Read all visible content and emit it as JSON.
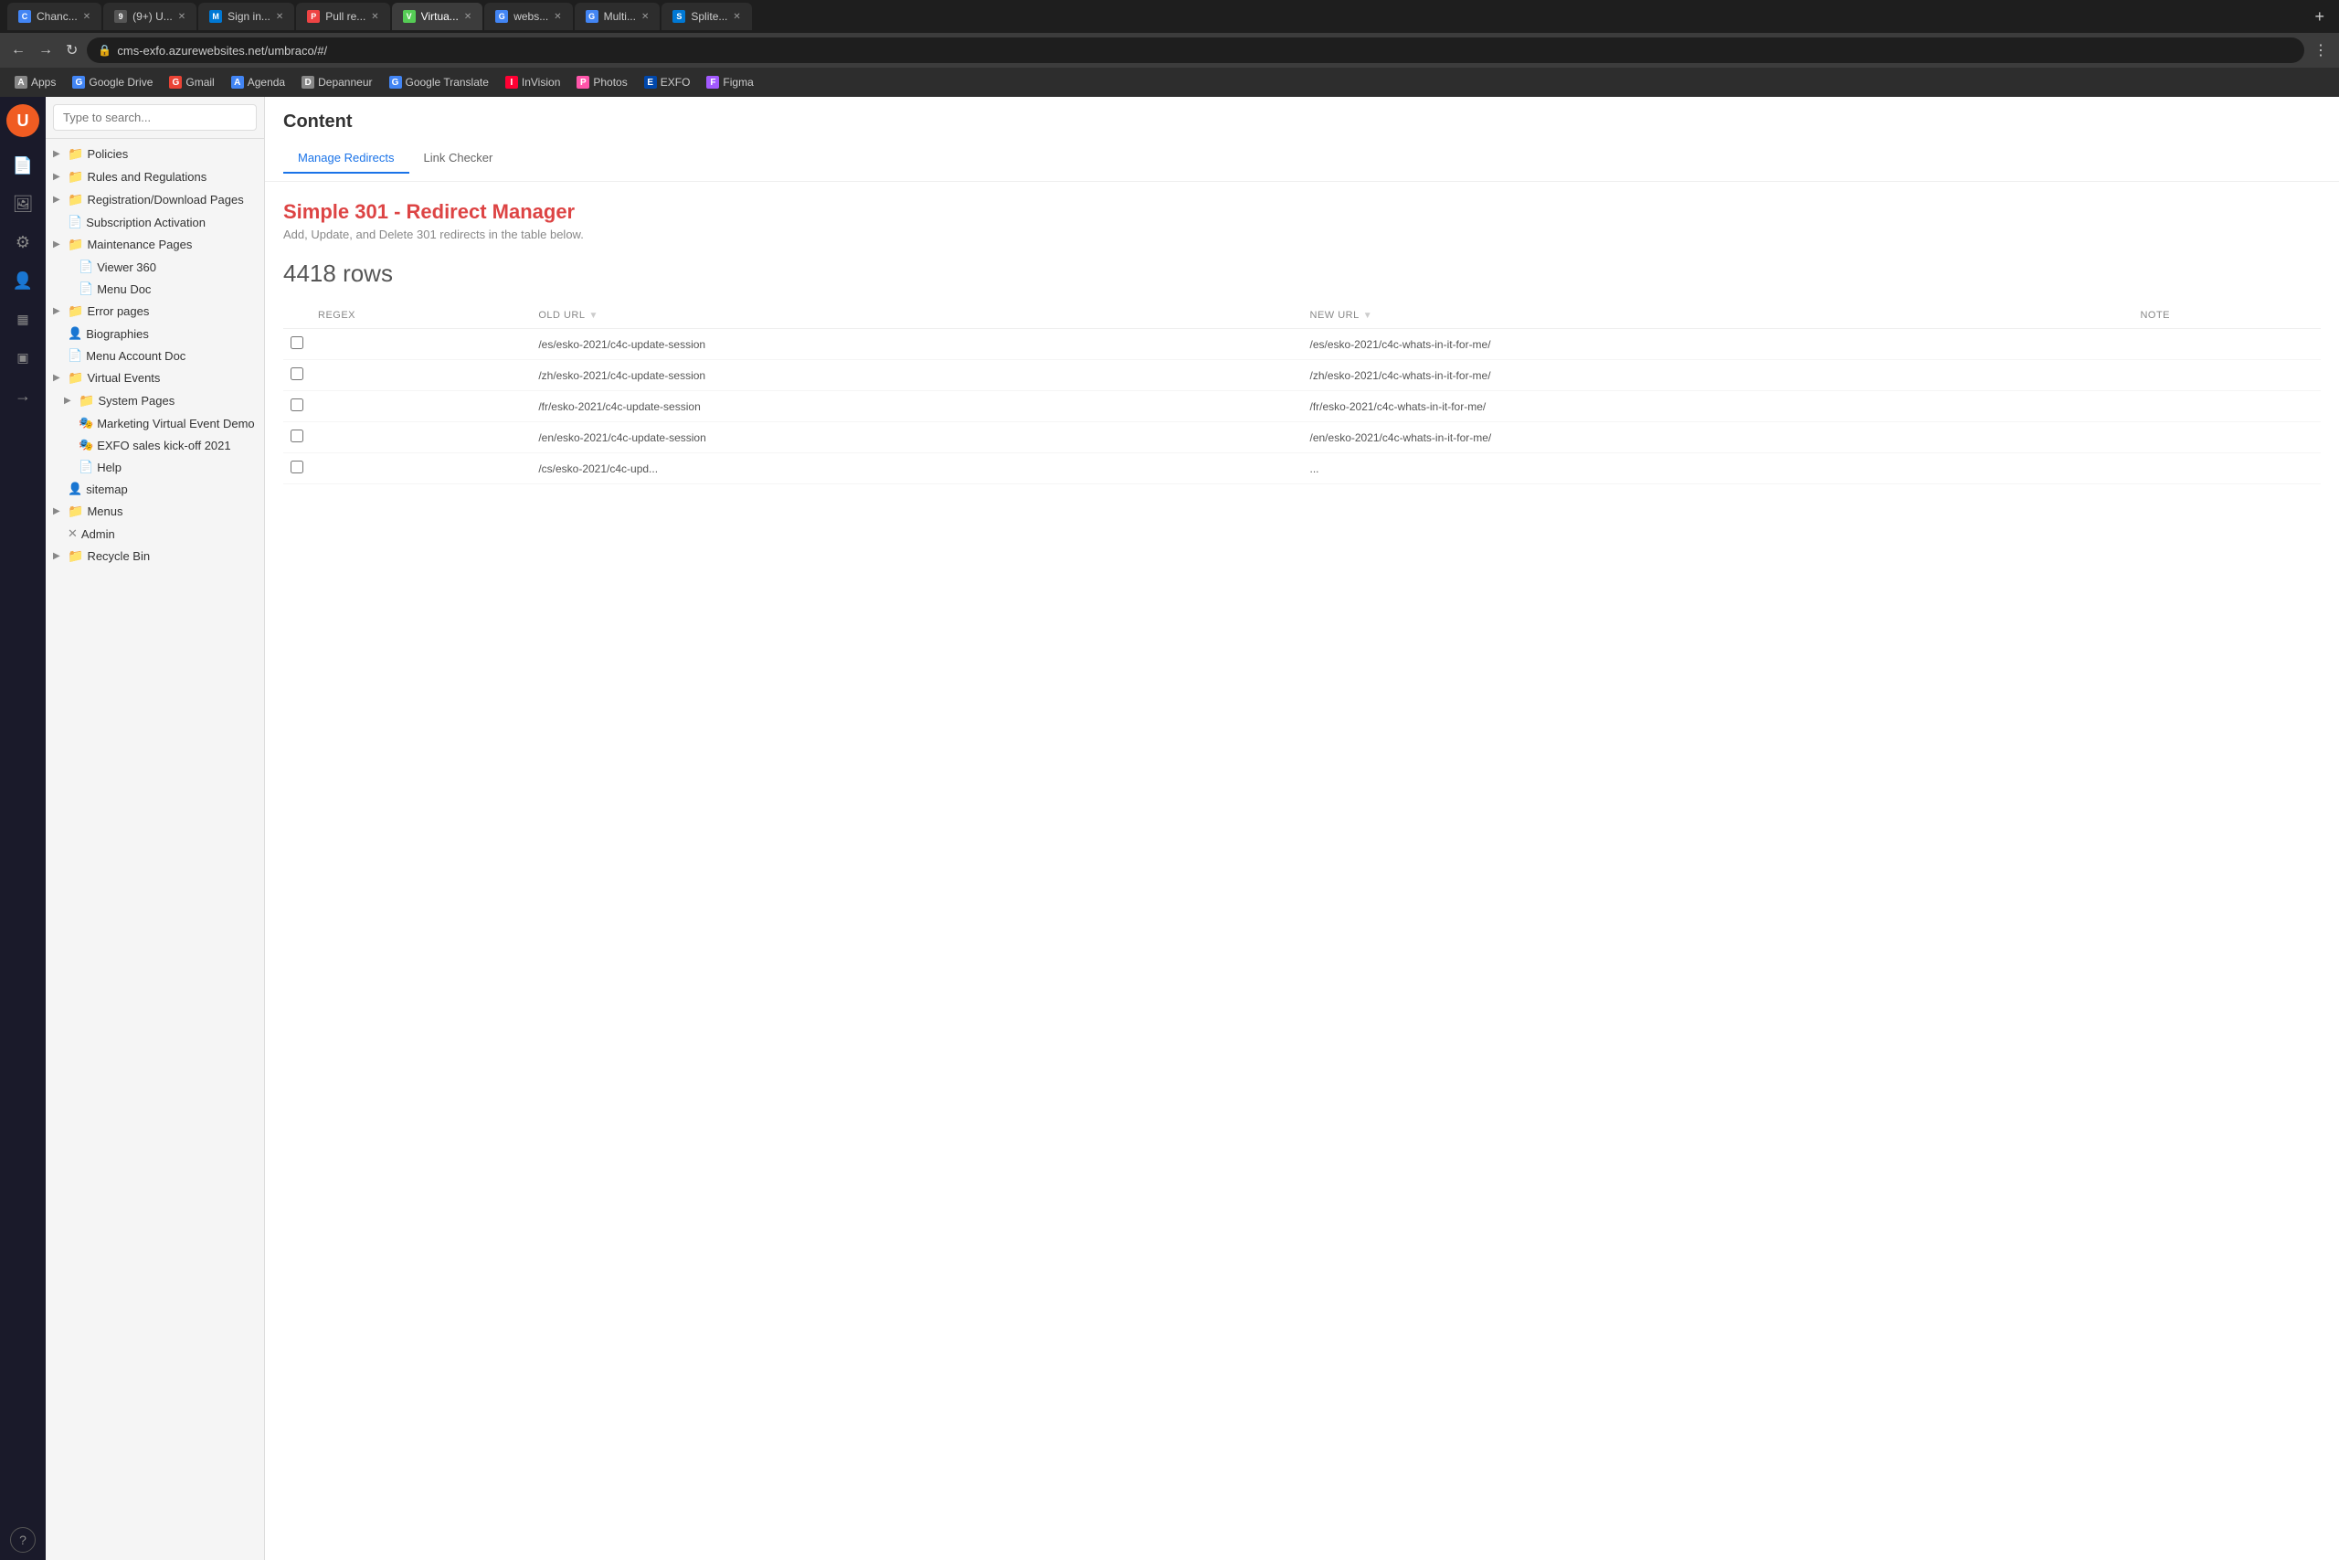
{
  "browser": {
    "tabs": [
      {
        "id": "t1",
        "favicon_char": "C",
        "favicon_bg": "#4285f4",
        "label": "Chanc...",
        "active": false
      },
      {
        "id": "t2",
        "favicon_char": "9",
        "favicon_bg": "#555",
        "label": "(9+) U...",
        "active": false
      },
      {
        "id": "t3",
        "favicon_char": "M",
        "favicon_bg": "#0078d4",
        "label": "Sign in...",
        "active": false
      },
      {
        "id": "t4",
        "favicon_char": "P",
        "favicon_bg": "#e44",
        "label": "Pull re...",
        "active": false
      },
      {
        "id": "t5",
        "favicon_char": "V",
        "favicon_bg": "#5c5",
        "label": "Virtua...",
        "active": true
      },
      {
        "id": "t6",
        "favicon_char": "G",
        "favicon_bg": "#4285f4",
        "label": "webs...",
        "active": false
      },
      {
        "id": "t7",
        "favicon_char": "G",
        "favicon_bg": "#4285f4",
        "label": "Multi...",
        "active": false
      },
      {
        "id": "t8",
        "favicon_char": "S",
        "favicon_bg": "#0078d4",
        "label": "Splite...",
        "active": false
      }
    ],
    "address": "cms-exfo.azurewebsites.net/umbraco/#/",
    "bookmarks": [
      {
        "label": "Apps",
        "favicon_char": "A",
        "favicon_bg": "#888"
      },
      {
        "label": "Google Drive",
        "favicon_char": "G",
        "favicon_bg": "#4285f4"
      },
      {
        "label": "Gmail",
        "favicon_char": "G",
        "favicon_bg": "#ea4335"
      },
      {
        "label": "Agenda",
        "favicon_char": "A",
        "favicon_bg": "#4285f4"
      },
      {
        "label": "Depanneur",
        "favicon_char": "D",
        "favicon_bg": "#888"
      },
      {
        "label": "Google Translate",
        "favicon_char": "G",
        "favicon_bg": "#4285f4"
      },
      {
        "label": "InVision",
        "favicon_char": "I",
        "favicon_bg": "#f03"
      },
      {
        "label": "Photos",
        "favicon_char": "P",
        "favicon_bg": "#f5a"
      },
      {
        "label": "EXFO",
        "favicon_char": "E",
        "favicon_bg": "#0047ab"
      },
      {
        "label": "Figma",
        "favicon_char": "F",
        "favicon_bg": "#a259ff"
      }
    ]
  },
  "sidebar": {
    "logo_char": "U",
    "icons": [
      {
        "name": "content-icon",
        "char": "📄"
      },
      {
        "name": "media-icon",
        "char": "🖼"
      },
      {
        "name": "settings-icon",
        "char": "⚙"
      },
      {
        "name": "users-icon",
        "char": "👤"
      },
      {
        "name": "forms-icon",
        "char": "▦"
      },
      {
        "name": "packages-icon",
        "char": "▣"
      },
      {
        "name": "redirect-icon",
        "char": "→"
      },
      {
        "name": "help-icon",
        "char": "?"
      }
    ]
  },
  "tree": {
    "search_placeholder": "Type to search...",
    "items": [
      {
        "id": "policies",
        "label": "Policies",
        "indent": 0,
        "type": "folder",
        "expanded": false
      },
      {
        "id": "rules",
        "label": "Rules and Regulations",
        "indent": 0,
        "type": "folder",
        "expanded": false
      },
      {
        "id": "reg-download",
        "label": "Registration/Download Pages",
        "indent": 0,
        "type": "folder",
        "expanded": false
      },
      {
        "id": "subscription",
        "label": "Subscription Activation",
        "indent": 0,
        "type": "doc",
        "expanded": false
      },
      {
        "id": "maintenance",
        "label": "Maintenance Pages",
        "indent": 0,
        "type": "folder",
        "expanded": false
      },
      {
        "id": "viewer360",
        "label": "Viewer 360",
        "indent": 1,
        "type": "doc",
        "expanded": false
      },
      {
        "id": "menudoc",
        "label": "Menu Doc",
        "indent": 1,
        "type": "doc",
        "expanded": false
      },
      {
        "id": "errorpages",
        "label": "Error pages",
        "indent": 0,
        "type": "folder",
        "expanded": false
      },
      {
        "id": "biographies",
        "label": "Biographies",
        "indent": 0,
        "type": "users",
        "expanded": false
      },
      {
        "id": "menuaccountdoc",
        "label": "Menu Account Doc",
        "indent": 0,
        "type": "doc",
        "expanded": false
      },
      {
        "id": "virtualevents",
        "label": "Virtual Events",
        "indent": 0,
        "type": "folder",
        "expanded": true
      },
      {
        "id": "systempages",
        "label": "System Pages",
        "indent": 1,
        "type": "folder",
        "expanded": false
      },
      {
        "id": "marketingvirtual",
        "label": "Marketing Virtual Event Demo",
        "indent": 1,
        "type": "virtual",
        "expanded": false
      },
      {
        "id": "exfosales",
        "label": "EXFO sales kick-off 2021",
        "indent": 1,
        "type": "virtual",
        "expanded": false
      },
      {
        "id": "help",
        "label": "Help",
        "indent": 1,
        "type": "doc",
        "expanded": false,
        "has_more": true
      },
      {
        "id": "sitemap",
        "label": "sitemap",
        "indent": 0,
        "type": "users",
        "expanded": false
      },
      {
        "id": "menus",
        "label": "Menus",
        "indent": 0,
        "type": "folder",
        "expanded": false
      },
      {
        "id": "admin",
        "label": "Admin",
        "indent": 0,
        "type": "close",
        "expanded": false
      },
      {
        "id": "recyclebin",
        "label": "Recycle Bin",
        "indent": 0,
        "type": "folder",
        "expanded": false
      }
    ]
  },
  "content": {
    "title": "Content",
    "tabs": [
      {
        "id": "manage-redirects",
        "label": "Manage Redirects",
        "active": true
      },
      {
        "id": "link-checker",
        "label": "Link Checker",
        "active": false
      }
    ],
    "redirect_manager": {
      "title": "Simple 301 - Redirect Manager",
      "subtitle": "Add, Update, and Delete 301 redirects in the table below.",
      "rows_count": "4418 rows",
      "table_headers": [
        {
          "id": "regex",
          "label": "REGEX"
        },
        {
          "id": "old-url",
          "label": "OLD URL"
        },
        {
          "id": "sort1",
          "label": ""
        },
        {
          "id": "new-url",
          "label": "NEW URL"
        },
        {
          "id": "sort2",
          "label": ""
        },
        {
          "id": "notes",
          "label": "NOTE"
        }
      ],
      "rows": [
        {
          "checked": false,
          "old_url": "/es/esko-2021/c4c-update-session",
          "new_url": "/es/esko-2021/c4c-whats-in-it-for-me/"
        },
        {
          "checked": false,
          "old_url": "/zh/esko-2021/c4c-update-session",
          "new_url": "/zh/esko-2021/c4c-whats-in-it-for-me/"
        },
        {
          "checked": false,
          "old_url": "/fr/esko-2021/c4c-update-session",
          "new_url": "/fr/esko-2021/c4c-whats-in-it-for-me/"
        },
        {
          "checked": false,
          "old_url": "/en/esko-2021/c4c-update-session",
          "new_url": "/en/esko-2021/c4c-whats-in-it-for-me/"
        },
        {
          "checked": false,
          "old_url": "/cs/esko-2021/c4c-upd...",
          "new_url": "..."
        }
      ]
    }
  }
}
